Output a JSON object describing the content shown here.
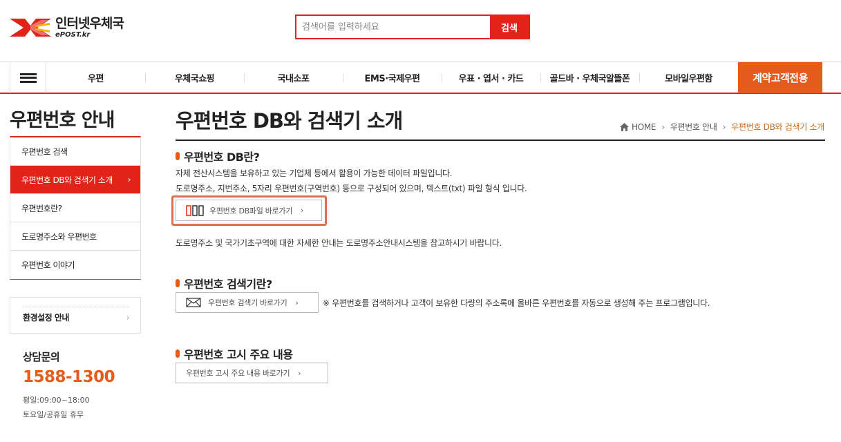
{
  "header": {
    "logo_ko": "인터넷우체국",
    "logo_en": "ePOST.kr",
    "search_placeholder": "검색어를 입력하세요",
    "search_button": "검색"
  },
  "gnb": {
    "items": [
      "우편",
      "우체국쇼핑",
      "국내소포",
      "EMS·국제우편",
      "우표 · 엽서 · 카드",
      "골드바 · 우체국알뜰폰",
      "모바일우편함"
    ],
    "special": "계약고객전용"
  },
  "sidebar": {
    "title": "우편번호 안내",
    "items": [
      {
        "label": "우편번호 검색"
      },
      {
        "label": "우편번호 DB와 검색기 소개"
      },
      {
        "label": "우편번호란?"
      },
      {
        "label": "도로명주소와 우편번호"
      },
      {
        "label": "우편번호 이야기"
      }
    ],
    "env_label": "환경설정 안내",
    "contact_title": "상담문의",
    "contact_phone": "1588-1300",
    "hours_weekday": "평일:09:00~18:00",
    "hours_weekend": "토요일/공휴일 휴무"
  },
  "content": {
    "page_title": "우편번호 DB와 검색기 소개",
    "breadcrumb": [
      "HOME",
      "우편번호 안내",
      "우편번호 DB와 검색기 소개"
    ],
    "sec1_title": "우편번호 DB란?",
    "sec1_line1": "자체 전산시스템을 보유하고 있는 기업체 등에서 활용이 가능한 데이터 파일입니다.",
    "sec1_line2": "도로명주소, 지번주소, 5자리 우편번호(구역번호) 등으로 구성되어 있으며, 텍스트(txt) 파일 형식 입니다.",
    "sec1_button": "우편번호 DB파일 바로가기",
    "sec1_note": "도로명주소 및 국가기초구역에 대한 자세한 안내는 도로명주소안내시스템을 참고하시기 바랍니다.",
    "sec2_title": "우편번호 검색기란?",
    "sec2_button": "우편번호 검색기 바로가기",
    "sec2_note": "※ 우편번호를 검색하거나 고객이 보유한 다량의 주소록에 올바른 우편번호를 자동으로 생성해 주는 프로그램입니다.",
    "sec3_title": "우편번호 고시 주요 내용",
    "sec3_button": "우편번호 고시 주요 내용 바로가기"
  },
  "colors": {
    "brand_red": "#e2231a",
    "accent_orange": "#e35c1c",
    "breadcrumb_current": "#c9691b"
  }
}
